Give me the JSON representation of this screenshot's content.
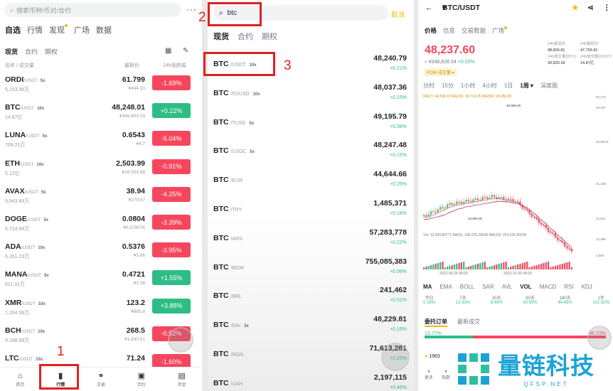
{
  "panel1": {
    "search_placeholder": "搜索币种/币对/合约",
    "more": "···",
    "tabs": [
      "自选",
      "行情",
      "发现",
      "广场",
      "数据"
    ],
    "subtabs": [
      "现货",
      "合约",
      "期权"
    ],
    "col_name": "名称 / 成交量",
    "col_price": "最新价",
    "col_change": "24h涨跌幅",
    "rows": [
      {
        "sym": "ORDI",
        "pair": "/USDT",
        "lev": "5x",
        "vol": "5,153.96万",
        "price": "61.799",
        "cny": "¥444.33",
        "chg": "-1.69%",
        "dir": "neg"
      },
      {
        "sym": "BTC",
        "pair": "/USDT",
        "lev": "10x",
        "vol": "14.87亿",
        "price": "48,248.01",
        "cny": "¥346,903.19",
        "chg": "+0.22%",
        "dir": "pos"
      },
      {
        "sym": "LUNA",
        "pair": "/USDT",
        "lev": "5x",
        "vol": "709.21万",
        "price": "0.6543",
        "cny": "¥4.7",
        "chg": "-5.04%",
        "dir": "neg"
      },
      {
        "sym": "ETH",
        "pair": "/USDT",
        "lev": "10x",
        "vol": "5.12亿",
        "price": "2,503.99",
        "cny": "¥18,003.68",
        "chg": "-0.91%",
        "dir": "neg"
      },
      {
        "sym": "AVAX",
        "pair": "/USDT",
        "lev": "5x",
        "vol": "9,943.84万",
        "price": "38.94",
        "cny": "¥279.97",
        "chg": "-4.25%",
        "dir": "neg"
      },
      {
        "sym": "DOGE",
        "pair": "/USDT",
        "lev": "5x",
        "vol": "5,714.94万",
        "price": "0.0804",
        "cny": "¥0.578076",
        "chg": "-3.39%",
        "dir": "neg"
      },
      {
        "sym": "ADA",
        "pair": "/USDT",
        "lev": "10x",
        "vol": "6,351.23万",
        "price": "0.5376",
        "cny": "¥3.86",
        "chg": "-3.95%",
        "dir": "neg"
      },
      {
        "sym": "MANA",
        "pair": "/USDT",
        "lev": "5x",
        "vol": "611.31万",
        "price": "0.4721",
        "cny": "¥3.39",
        "chg": "+1.55%",
        "dir": "pos"
      },
      {
        "sym": "XMR",
        "pair": "/USDT",
        "lev": "10x",
        "vol": "1,334.58万",
        "price": "123.2",
        "cny": "¥885.8",
        "chg": "+3.88%",
        "dir": "pos"
      },
      {
        "sym": "BCH",
        "pair": "/USDT",
        "lev": "10x",
        "vol": "9,168.89万",
        "price": "268.5",
        "cny": "¥1,930.51",
        "chg": "-0.52%",
        "dir": "neg"
      },
      {
        "sym": "LTC",
        "pair": "/USDT",
        "lev": "10x",
        "vol": "",
        "price": "71.24",
        "cny": "",
        "chg": "-1.60%",
        "dir": "neg"
      }
    ],
    "nav": [
      "首页",
      "行情",
      "交易",
      "合约",
      "资金"
    ],
    "nav_icons": [
      "⌂",
      "▮",
      "⚭",
      "▣",
      "▤"
    ]
  },
  "panel2": {
    "search_value": "btc",
    "cancel": "取消",
    "tabs": [
      "现货",
      "合约",
      "期权"
    ],
    "rows": [
      {
        "sym": "BTC",
        "pair": "/USDT",
        "lev": "10x",
        "price": "48,240.79",
        "chg": "+0.21%"
      },
      {
        "sym": "BTC",
        "pair": "/FDUSD",
        "lev": "10x",
        "price": "48,037.36",
        "chg": "+0.15%"
      },
      {
        "sym": "BTC",
        "pair": "/TUSD",
        "lev": "5x",
        "price": "49,195.79",
        "chg": "+0.58%"
      },
      {
        "sym": "BTC",
        "pair": "/USDC",
        "lev": "5x",
        "price": "48,247.48",
        "chg": "+0.15%"
      },
      {
        "sym": "BTC",
        "pair": "/EUR",
        "lev": "",
        "price": "44,644.66",
        "chg": "+0.25%"
      },
      {
        "sym": "BTC",
        "pair": "/TRY",
        "lev": "",
        "price": "1,485,371",
        "chg": "+0.18%"
      },
      {
        "sym": "BTC",
        "pair": "/ARS",
        "lev": "",
        "price": "57,283,778",
        "chg": "+0.22%"
      },
      {
        "sym": "BTC",
        "pair": "/BIDR",
        "lev": "",
        "price": "755,085,383",
        "chg": "+0.08%"
      },
      {
        "sym": "BTC",
        "pair": "/BRL",
        "lev": "",
        "price": "241,462",
        "chg": "+0.51%"
      },
      {
        "sym": "BTC",
        "pair": "/DAI",
        "lev": "3x",
        "price": "48,229.81",
        "chg": "+0.16%"
      },
      {
        "sym": "BTC",
        "pair": "/NGN",
        "lev": "",
        "price": "71,613,281",
        "chg": "+0.25%"
      },
      {
        "sym": "BTC",
        "pair": "/UAH",
        "lev": "",
        "price": "2,197,115",
        "chg": "+0.46%"
      }
    ]
  },
  "panel3": {
    "back": "←",
    "title": "BTC/USDT",
    "caret": "▾",
    "star": "★",
    "share": "⋖",
    "more": "⋮",
    "tabs": [
      "价格",
      "信息",
      "交易数据",
      "广场"
    ],
    "price": "48,237.60",
    "cny": "≈ ¥346,828.34",
    "chg": "+0.20%",
    "badge": "POW  成交量 ▾",
    "stats": [
      {
        "k": "24h最高价",
        "v": "48,826.81"
      },
      {
        "k": "24h最低价",
        "v": "47,755.81"
      },
      {
        "k": "24h成交量(BTC)",
        "v": "30,820.18"
      },
      {
        "k": "24h成交额(USDT)",
        "v": "14.87亿"
      }
    ],
    "timeframes": [
      "分时",
      "15分",
      "1小时",
      "4小时",
      "1日",
      "1周 ▾",
      "深度图"
    ],
    "ma_line": "MA(7): 44,098.18   MA(25): 36,714.35   MA(99): 29,050.85",
    "axis_right": [
      "50,173",
      "48,237",
      "40,684.5",
      "31,158",
      "21,811",
      "12,388",
      "3,000"
    ],
    "chart_labels": [
      "48,969.48",
      "24,800.00"
    ],
    "vol_line": "Vol: 12,009.86771   MA(5): 186,075.28936   MA(10): 253,616.90290",
    "dates": [
      "2023-08-26 08:00",
      "2023-10-30 08:00"
    ],
    "indicators": [
      "MA",
      "EMA",
      "BOLL",
      "SAR",
      "AVL",
      "VOL",
      "MACD",
      "RSI",
      "KDJ"
    ],
    "perf": [
      {
        "k": "今日",
        "v": "0.18%"
      },
      {
        "k": "7天",
        "v": "12.33%"
      },
      {
        "k": "30天",
        "v": "8.49%"
      },
      {
        "k": "90天",
        "v": "30.93%"
      },
      {
        "k": "180天",
        "v": "44.45%"
      },
      {
        "k": "1年",
        "v": "121.92%"
      }
    ],
    "ob_tabs": [
      "委托订单",
      "最新成交"
    ],
    "bid_pct": "13.77%",
    "ask_pct": "86.23%",
    "ob_val": "1983",
    "bottom": [
      "更多",
      "指数"
    ],
    "bottom_icons": [
      "●",
      "●"
    ]
  },
  "annotations": {
    "n1": "1",
    "n2": "2",
    "n3": "3"
  },
  "watermark": {
    "cn": "量链科技",
    "en": "QFSP.NET"
  },
  "colors": {
    "red": "#f6465d",
    "green": "#2ebd85",
    "accent": "#f0b90b",
    "annotation": "#e02020"
  }
}
